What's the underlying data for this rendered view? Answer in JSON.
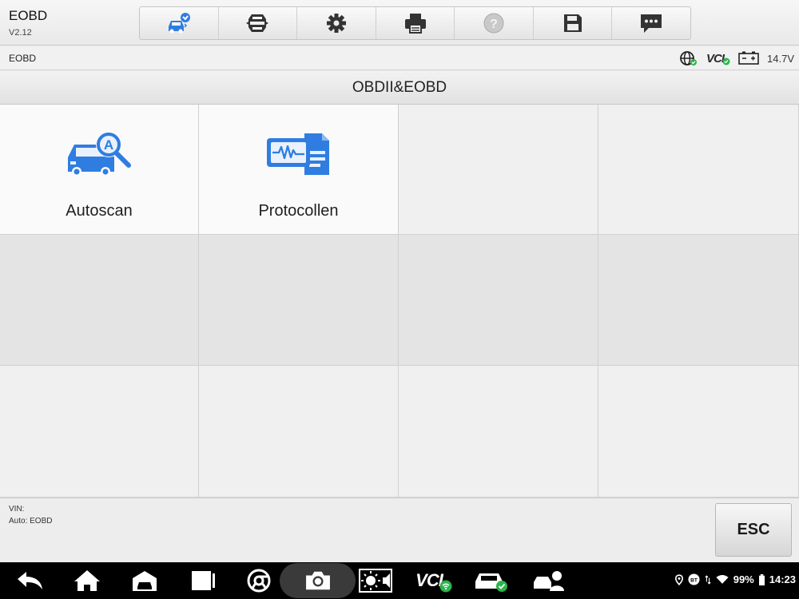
{
  "app": {
    "title": "EOBD",
    "version": "V2.12"
  },
  "toolbar": {
    "items": [
      {
        "icon": "vehicle-home-icon"
      },
      {
        "icon": "change-vehicle-icon"
      },
      {
        "icon": "settings-gear-icon"
      },
      {
        "icon": "printer-icon"
      },
      {
        "icon": "help-icon"
      },
      {
        "icon": "save-icon"
      },
      {
        "icon": "data-logging-icon"
      }
    ],
    "active_color": "#2f7de1"
  },
  "status_bar": {
    "breadcrumb": "EOBD",
    "vci_label": "VCI",
    "voltage": "14.7V",
    "ok_color": "#2bb54a"
  },
  "section": {
    "title": "OBDII&EOBD"
  },
  "functions": [
    {
      "label": "Autoscan",
      "icon": "car-autoscan-icon"
    },
    {
      "label": "Protocollen",
      "icon": "protocol-waveform-icon"
    }
  ],
  "footer": {
    "vin_label": "VIN:",
    "auto_label": "Auto: EOBD",
    "esc_label": "ESC"
  },
  "navbar": {
    "vci_label": "VCI",
    "battery": "99%",
    "time": "14:23"
  }
}
